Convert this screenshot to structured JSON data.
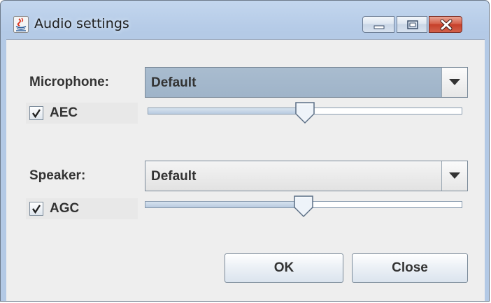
{
  "window": {
    "title": "Audio settings",
    "controls": [
      "minimize-icon",
      "maximize-icon",
      "close-icon"
    ]
  },
  "microphone": {
    "label": "Microphone:",
    "selected": "Default",
    "checkbox_label": "AEC",
    "checked": true,
    "volume_fraction": 0.5
  },
  "speaker": {
    "label": "Speaker:",
    "selected": "Default",
    "checkbox_label": "AGC",
    "checked": true,
    "volume_fraction": 0.5
  },
  "buttons": {
    "ok": "OK",
    "close": "Close"
  },
  "colors": {
    "title_bar": "#b8cde8",
    "panel": "#eeeeee",
    "close_button": "#c94a35",
    "active_combo": "#a5b9cd"
  }
}
